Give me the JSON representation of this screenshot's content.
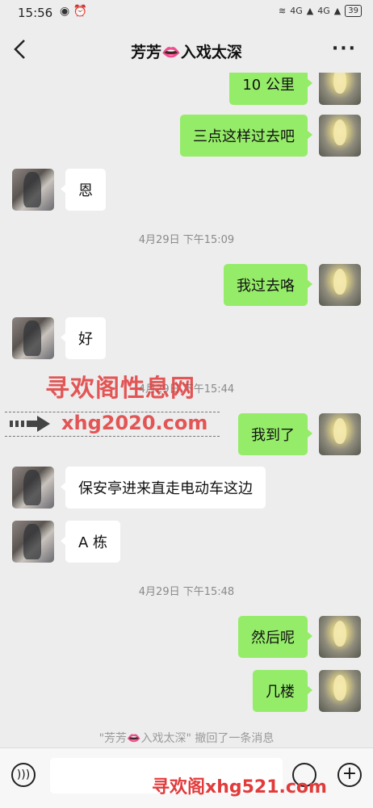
{
  "status_bar": {
    "time": "15:56",
    "signal_1": "4G",
    "signal_2": "4G",
    "battery": "39"
  },
  "nav": {
    "title": "芳芳👄入戏太深",
    "more_icon": "more-icon"
  },
  "messages": [
    {
      "side": "self",
      "text": "10 公里"
    },
    {
      "side": "self",
      "text": "三点这样过去吧"
    },
    {
      "side": "other",
      "text": "恩"
    },
    {
      "side": "time",
      "text": "4月29日 下午15:09"
    },
    {
      "side": "self",
      "text": "我过去咯"
    },
    {
      "side": "other",
      "text": "好"
    },
    {
      "side": "time",
      "text": "4月29日 下午15:44"
    },
    {
      "side": "self",
      "text": "我到了"
    },
    {
      "side": "other",
      "text": "保安亭进来直走电动车这边"
    },
    {
      "side": "other",
      "text": "A 栋"
    },
    {
      "side": "time",
      "text": "4月29日 下午15:48"
    },
    {
      "side": "self",
      "text": "然后呢"
    },
    {
      "side": "self",
      "text": "几楼"
    }
  ],
  "recall_notice": "\"芳芳👄入戏太深\" 撤回了一条消息",
  "watermark": {
    "title": "寻欢阁性息网",
    "url": "xhg2020.com",
    "footer": "寻欢阁xhg521.com"
  },
  "input": {
    "placeholder": ""
  },
  "colors": {
    "self_bubble": "#95ec69",
    "other_bubble": "#ffffff",
    "background": "#ededed",
    "watermark": "#e23b3b"
  }
}
